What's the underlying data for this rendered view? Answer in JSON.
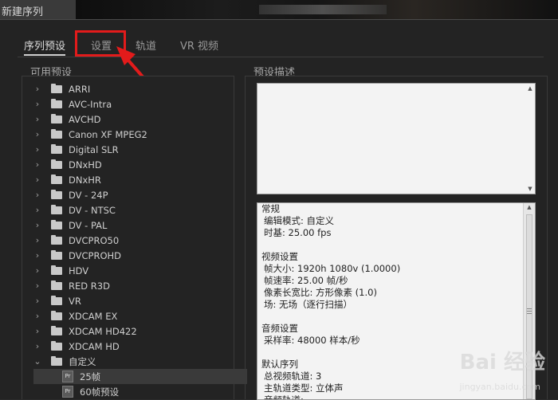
{
  "window": {
    "title": "新建序列"
  },
  "tabs": [
    {
      "label": "序列预设",
      "active": true
    },
    {
      "label": "设置",
      "active": false
    },
    {
      "label": "轨道",
      "active": false
    },
    {
      "label": "VR 视频",
      "active": false
    }
  ],
  "left_panel": {
    "title": "可用预设",
    "items": [
      {
        "label": "ARRI",
        "type": "folder",
        "expanded": false
      },
      {
        "label": "AVC-Intra",
        "type": "folder",
        "expanded": false
      },
      {
        "label": "AVCHD",
        "type": "folder",
        "expanded": false
      },
      {
        "label": "Canon XF MPEG2",
        "type": "folder",
        "expanded": false
      },
      {
        "label": "Digital SLR",
        "type": "folder",
        "expanded": false
      },
      {
        "label": "DNxHD",
        "type": "folder",
        "expanded": false
      },
      {
        "label": "DNxHR",
        "type": "folder",
        "expanded": false
      },
      {
        "label": "DV - 24P",
        "type": "folder",
        "expanded": false
      },
      {
        "label": "DV - NTSC",
        "type": "folder",
        "expanded": false
      },
      {
        "label": "DV - PAL",
        "type": "folder",
        "expanded": false
      },
      {
        "label": "DVCPRO50",
        "type": "folder",
        "expanded": false
      },
      {
        "label": "DVCPROHD",
        "type": "folder",
        "expanded": false
      },
      {
        "label": "HDV",
        "type": "folder",
        "expanded": false
      },
      {
        "label": "RED R3D",
        "type": "folder",
        "expanded": false
      },
      {
        "label": "VR",
        "type": "folder",
        "expanded": false
      },
      {
        "label": "XDCAM EX",
        "type": "folder",
        "expanded": false
      },
      {
        "label": "XDCAM HD422",
        "type": "folder",
        "expanded": false
      },
      {
        "label": "XDCAM HD",
        "type": "folder",
        "expanded": false
      },
      {
        "label": "自定义",
        "type": "folder",
        "expanded": true
      },
      {
        "label": "25帧",
        "type": "preset",
        "selected": true
      },
      {
        "label": "60帧预设",
        "type": "preset",
        "selected": false
      }
    ],
    "preset_badge": "Pr"
  },
  "right_panel": {
    "title": "预设描述",
    "info_lines": [
      {
        "text": "常规",
        "indent": false
      },
      {
        "text": "编辑模式: 自定义",
        "indent": true
      },
      {
        "text": "时基: 25.00 fps",
        "indent": true
      },
      {
        "text": "",
        "indent": false
      },
      {
        "text": "视频设置",
        "indent": false
      },
      {
        "text": "帧大小: 1920h 1080v (1.0000)",
        "indent": true
      },
      {
        "text": "帧速率: 25.00  帧/秒",
        "indent": true
      },
      {
        "text": "像素长宽比: 方形像素 (1.0)",
        "indent": true
      },
      {
        "text": "场: 无场（逐行扫描）",
        "indent": true
      },
      {
        "text": "",
        "indent": false
      },
      {
        "text": "音频设置",
        "indent": false
      },
      {
        "text": "采样率: 48000 样本/秒",
        "indent": true
      },
      {
        "text": "",
        "indent": false
      },
      {
        "text": "默认序列",
        "indent": false
      },
      {
        "text": "总视频轨道: 3",
        "indent": true
      },
      {
        "text": "主轨道类型: 立体声",
        "indent": true
      },
      {
        "text": "音频轨道:",
        "indent": true
      }
    ]
  },
  "watermark": {
    "brand": "Bai 经验",
    "url": "jingyan.baidu.com"
  },
  "colors": {
    "highlight": "#e21b1b",
    "dialog_bg": "#232323",
    "info_bg": "#f3f3f3"
  }
}
